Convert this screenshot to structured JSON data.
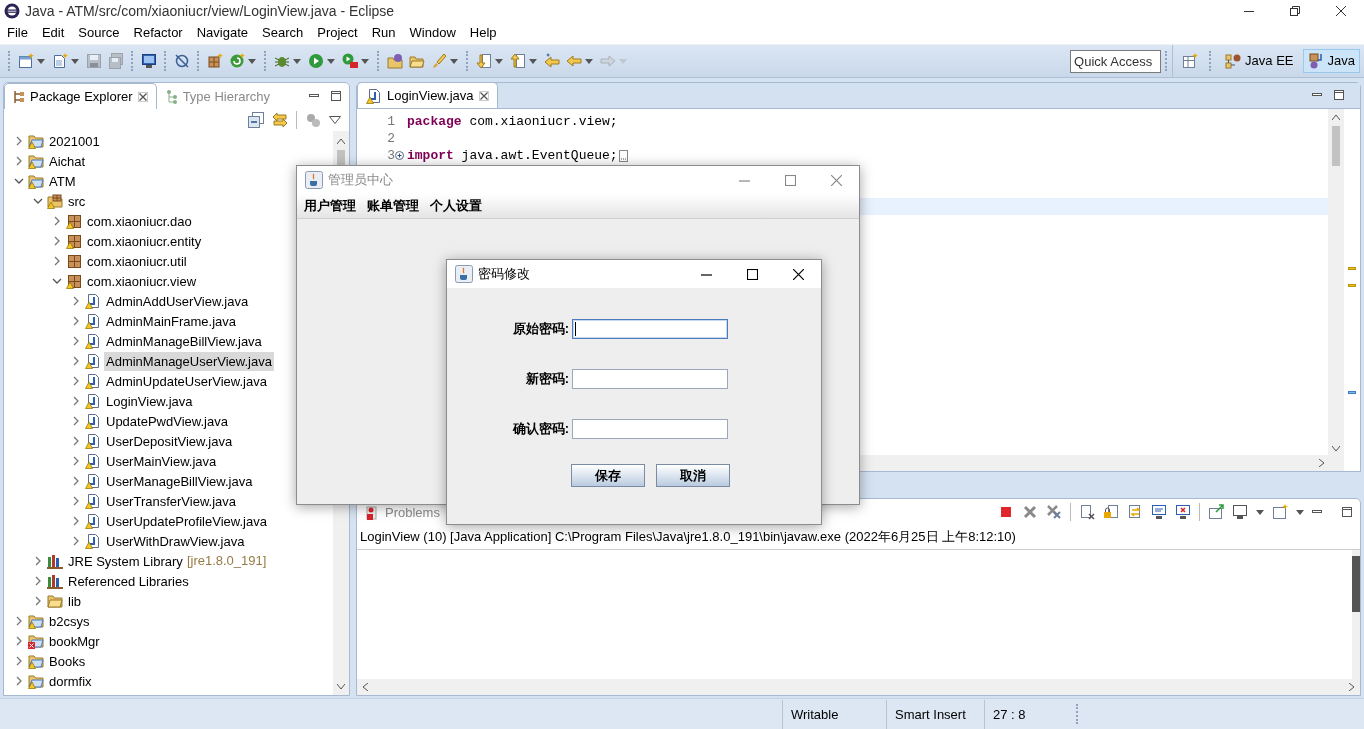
{
  "window": {
    "title": "Java - ATM/src/com/xiaoniucr/view/LoginView.java - Eclipse"
  },
  "menu": [
    "File",
    "Edit",
    "Source",
    "Refactor",
    "Navigate",
    "Search",
    "Project",
    "Run",
    "Window",
    "Help"
  ],
  "toolbar": [
    {
      "kind": "new-window",
      "dropdown": true,
      "disabled": false,
      "group_start": false
    },
    {
      "kind": "new-file",
      "dropdown": true,
      "disabled": false,
      "group_start": false
    },
    {
      "kind": "save",
      "dropdown": false,
      "disabled": true,
      "group_start": false
    },
    {
      "kind": "save-all",
      "dropdown": false,
      "disabled": true,
      "group_start": false
    },
    {
      "kind": "monitor",
      "dropdown": false,
      "disabled": false,
      "group_start": true
    },
    {
      "kind": "unlink",
      "dropdown": false,
      "disabled": false,
      "group_start": true
    },
    {
      "kind": "package",
      "dropdown": false,
      "disabled": false,
      "group_start": true
    },
    {
      "kind": "refresh",
      "dropdown": true,
      "disabled": false,
      "group_start": false
    },
    {
      "kind": "debug",
      "dropdown": true,
      "disabled": false,
      "group_start": true
    },
    {
      "kind": "run",
      "dropdown": true,
      "disabled": false,
      "group_start": false
    },
    {
      "kind": "run-external",
      "dropdown": true,
      "disabled": false,
      "group_start": false
    },
    {
      "kind": "folder-ball",
      "dropdown": false,
      "disabled": false,
      "group_start": true
    },
    {
      "kind": "folder",
      "dropdown": false,
      "disabled": false,
      "group_start": false
    },
    {
      "kind": "brush",
      "dropdown": true,
      "disabled": false,
      "group_start": false
    },
    {
      "kind": "down",
      "dropdown": true,
      "disabled": false,
      "group_start": true
    },
    {
      "kind": "up",
      "dropdown": true,
      "disabled": false,
      "group_start": false
    },
    {
      "kind": "back-star",
      "dropdown": false,
      "disabled": false,
      "group_start": false
    },
    {
      "kind": "back",
      "dropdown": true,
      "disabled": false,
      "group_start": false
    },
    {
      "kind": "forward",
      "dropdown": true,
      "disabled": true,
      "group_start": false
    }
  ],
  "quick_access": {
    "placeholder": "Quick Access"
  },
  "perspectives": [
    {
      "label": "Java EE",
      "selected": false
    },
    {
      "label": "Java",
      "selected": true
    }
  ],
  "package_explorer": {
    "tabs": [
      {
        "label": "Package Explorer",
        "selected": true
      },
      {
        "label": "Type Hierarchy",
        "selected": false
      }
    ],
    "tree": [
      {
        "label": "2021001",
        "kind": "project",
        "warning": true,
        "error": false,
        "expanded": false,
        "selected": false
      },
      {
        "label": "Aichat",
        "kind": "project",
        "warning": true,
        "error": false,
        "expanded": false,
        "selected": false
      },
      {
        "label": "ATM",
        "kind": "project",
        "warning": true,
        "error": false,
        "expanded": true,
        "selected": false,
        "children": [
          {
            "label": "src",
            "kind": "source",
            "warning": true,
            "error": false,
            "expanded": true,
            "selected": false,
            "children": [
              {
                "label": "com.xiaoniucr.dao",
                "kind": "package",
                "warning": true,
                "error": false,
                "expanded": false,
                "selected": false
              },
              {
                "label": "com.xiaoniucr.entity",
                "kind": "package",
                "warning": true,
                "error": false,
                "expanded": false,
                "selected": false
              },
              {
                "label": "com.xiaoniucr.util",
                "kind": "package",
                "warning": false,
                "error": false,
                "expanded": false,
                "selected": false
              },
              {
                "label": "com.xiaoniucr.view",
                "kind": "package",
                "warning": true,
                "error": false,
                "expanded": true,
                "selected": false,
                "children": [
                  {
                    "label": "AdminAddUserView.java",
                    "kind": "java",
                    "warning": true,
                    "error": false,
                    "expanded": false,
                    "selected": false
                  },
                  {
                    "label": "AdminMainFrame.java",
                    "kind": "java",
                    "warning": true,
                    "error": false,
                    "expanded": false,
                    "selected": false
                  },
                  {
                    "label": "AdminManageBillView.java",
                    "kind": "java",
                    "warning": true,
                    "error": false,
                    "expanded": false,
                    "selected": false
                  },
                  {
                    "label": "AdminManageUserView.java",
                    "kind": "java",
                    "warning": true,
                    "error": false,
                    "expanded": false,
                    "selected": true
                  },
                  {
                    "label": "AdminUpdateUserView.java",
                    "kind": "java",
                    "warning": true,
                    "error": false,
                    "expanded": false,
                    "selected": false
                  },
                  {
                    "label": "LoginView.java",
                    "kind": "java",
                    "warning": true,
                    "error": false,
                    "expanded": false,
                    "selected": false
                  },
                  {
                    "label": "UpdatePwdView.java",
                    "kind": "java",
                    "warning": true,
                    "error": false,
                    "expanded": false,
                    "selected": false
                  },
                  {
                    "label": "UserDepositView.java",
                    "kind": "java",
                    "warning": true,
                    "error": false,
                    "expanded": false,
                    "selected": false
                  },
                  {
                    "label": "UserMainView.java",
                    "kind": "java",
                    "warning": true,
                    "error": false,
                    "expanded": false,
                    "selected": false
                  },
                  {
                    "label": "UserManageBillView.java",
                    "kind": "java",
                    "warning": true,
                    "error": false,
                    "expanded": false,
                    "selected": false
                  },
                  {
                    "label": "UserTransferView.java",
                    "kind": "java",
                    "warning": true,
                    "error": false,
                    "expanded": false,
                    "selected": false
                  },
                  {
                    "label": "UserUpdateProfileView.java",
                    "kind": "java",
                    "warning": true,
                    "error": false,
                    "expanded": false,
                    "selected": false
                  },
                  {
                    "label": "UserWithDrawView.java",
                    "kind": "java",
                    "warning": true,
                    "error": false,
                    "expanded": false,
                    "selected": false
                  }
                ]
              }
            ]
          },
          {
            "label": "JRE System Library",
            "decoration": "[jre1.8.0_191]",
            "kind": "library",
            "warning": false,
            "error": false,
            "expanded": false,
            "selected": false
          },
          {
            "label": "Referenced Libraries",
            "kind": "library",
            "warning": false,
            "error": false,
            "expanded": false,
            "selected": false
          },
          {
            "label": "lib",
            "kind": "folder",
            "warning": false,
            "error": false,
            "expanded": false,
            "selected": false
          }
        ]
      },
      {
        "label": "b2csys",
        "kind": "project",
        "warning": true,
        "error": false,
        "expanded": false,
        "selected": false
      },
      {
        "label": "bookMgr",
        "kind": "project",
        "warning": false,
        "error": true,
        "expanded": false,
        "selected": false
      },
      {
        "label": "Books",
        "kind": "project",
        "warning": true,
        "error": false,
        "expanded": false,
        "selected": false
      },
      {
        "label": "dormfix",
        "kind": "project",
        "warning": true,
        "error": false,
        "expanded": false,
        "selected": false
      }
    ]
  },
  "editor": {
    "tabs": [
      {
        "label": "LoginView.java",
        "selected": true
      }
    ],
    "lines": [
      {
        "number": "1",
        "folded": false,
        "tokens": [
          {
            "kind": "keyword",
            "text": "package"
          },
          {
            "kind": "plain",
            "text": " com.xiaoniucr.view;"
          }
        ]
      },
      {
        "number": "2",
        "folded": false
      },
      {
        "number": "3",
        "folded": true,
        "tokens": [
          {
            "kind": "keyword",
            "text": "import"
          },
          {
            "kind": "plain",
            "text": " java.awt.EventQueue;"
          }
        ]
      }
    ]
  },
  "bottom_panel": {
    "tabs": [
      {
        "label": "Problems",
        "selected": false
      }
    ],
    "console_header": "LoginView (10) [Java Application] C:\\Program Files\\Java\\jre1.8.0_191\\bin\\javaw.exe (2022年6月25日 上午8:12:10)"
  },
  "status_bar": [
    "Writable",
    "Smart Insert",
    "27 : 8"
  ],
  "admin_window": {
    "title": "管理员中心",
    "active": false,
    "menu": [
      "用户管理",
      "账单管理",
      "个人设置"
    ]
  },
  "dialog": {
    "title": "密码修改",
    "active": true,
    "fields": [
      {
        "label": "原始密码:",
        "focused": true
      },
      {
        "label": "新密码:",
        "focused": false
      },
      {
        "label": "确认密码:",
        "focused": false
      }
    ],
    "buttons": [
      "保存",
      "取消"
    ]
  }
}
